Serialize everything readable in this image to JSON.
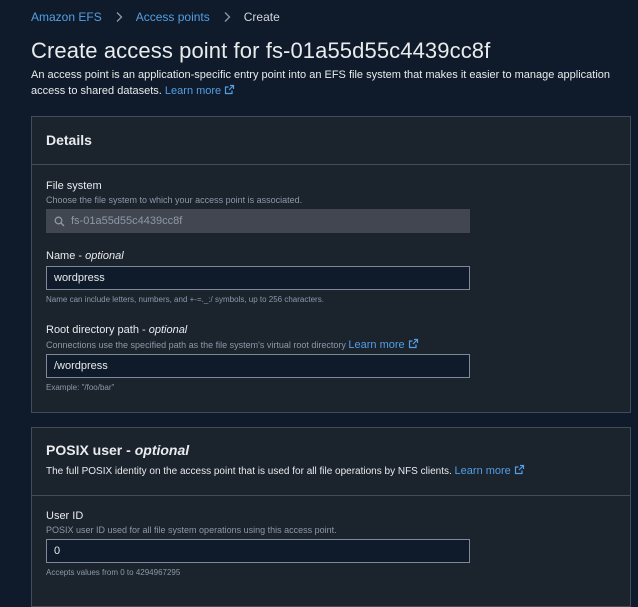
{
  "breadcrumb": {
    "items": [
      "Amazon EFS",
      "Access points"
    ],
    "current": "Create"
  },
  "page": {
    "title": "Create access point for fs-01a55d55c4439cc8f",
    "description": "An access point is an application-specific entry point into an EFS file system that makes it easier to manage application access to shared datasets.",
    "learn_more": "Learn more"
  },
  "details": {
    "title": "Details",
    "file_system": {
      "label": "File system",
      "description": "Choose the file system to which your access point is associated.",
      "value": "fs-01a55d55c4439cc8f"
    },
    "name": {
      "label": "Name",
      "optional": "optional",
      "value": "wordpress",
      "constraint": "Name can include letters, numbers, and +-=._:/ symbols, up to 256 characters."
    },
    "root_path": {
      "label": "Root directory path",
      "optional": "optional",
      "description": "Connections use the specified path as the file system's virtual root directory",
      "learn_more": "Learn more",
      "value": "/wordpress",
      "constraint": "Example: \"/foo/bar\""
    }
  },
  "posix": {
    "title": "POSIX user",
    "optional": "optional",
    "description": "The full POSIX identity on the access point that is used for all file operations by NFS clients.",
    "learn_more": "Learn more",
    "user_id": {
      "label": "User ID",
      "description": "POSIX user ID used for all file system operations using this access point.",
      "value": "0",
      "constraint": "Accepts values from 0 to 4294967295"
    }
  },
  "icons": {
    "breadcrumb_separator": "chevron-right-icon",
    "external_link": "external-link-icon",
    "search": "search-icon"
  },
  "colors": {
    "background": "#0f1b2a",
    "container": "#1b232d",
    "link": "#539fe5",
    "border": "#414d5c"
  }
}
